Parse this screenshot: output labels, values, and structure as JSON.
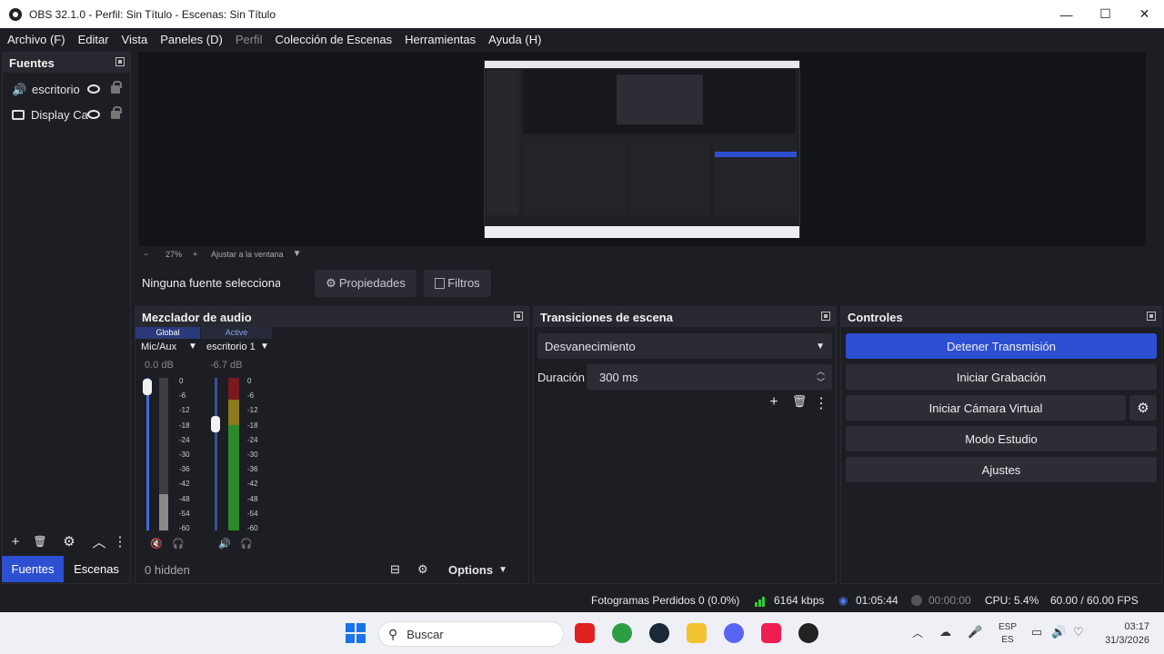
{
  "window": {
    "title": "OBS 32.1.0 - Perfil: Sin Título - Escenas: Sin Título",
    "min": "—",
    "max": "☐",
    "close": "✕"
  },
  "menu": [
    "Archivo (F)",
    "Editar",
    "Vista",
    "Paneles (D)",
    "Perfil",
    "Colección de Escenas",
    "Herramientas",
    "Ayuda (H)"
  ],
  "sources": {
    "title": "Fuentes",
    "items": [
      {
        "label": "escritorio",
        "icon": "speaker-icon"
      },
      {
        "label": "Display Ca",
        "icon": "monitor-icon"
      }
    ]
  },
  "tabs": {
    "fuentes": "Fuentes",
    "escenas": "Escenas"
  },
  "preview": {
    "zoom": "27%",
    "fit": "Ajustar a la ventana"
  },
  "source_bar": {
    "none": "Ninguna fuente seleccionac",
    "properties": "Propiedades",
    "filters": "Filtros"
  },
  "mixer": {
    "title": "Mezclador de audio",
    "channels": [
      {
        "tag": "Global",
        "name": "Mic/Aux",
        "db": "0.0 dB",
        "fader_level": 1.0
      },
      {
        "tag": "Active",
        "name": "escritorio 1",
        "db": "-6.7 dB",
        "fader_level": 0.75
      }
    ],
    "scale": [
      "0",
      "-6",
      "-12",
      "-18",
      "-24",
      "-30",
      "-36",
      "-42",
      "-48",
      "-54",
      "-60"
    ],
    "hidden": "0 hidden",
    "options": "Options"
  },
  "transitions": {
    "title": "Transiciones de escena",
    "selected": "Desvanecimiento",
    "duration_label": "Duración",
    "duration": "300 ms"
  },
  "controls": {
    "title": "Controles",
    "buttons": [
      "Detener Transmisión",
      "Iniciar Grabación",
      "Iniciar Cámara Virtual",
      "Modo Estudio",
      "Ajustes"
    ],
    "accent": "#2d4fd1"
  },
  "status": {
    "dropped": "Fotogramas Perdidos 0 (0.0%)",
    "bitrate": "6164 kbps",
    "stream_time": "01:05:44",
    "rec_time": "00:00:00",
    "cpu": "CPU: 5.4%",
    "fps": "60.00 / 60.00 FPS"
  },
  "taskbar": {
    "search": "Buscar",
    "lang1": "ESP",
    "lang2": "ES",
    "time": "03:17",
    "date": "31/3/2026"
  }
}
